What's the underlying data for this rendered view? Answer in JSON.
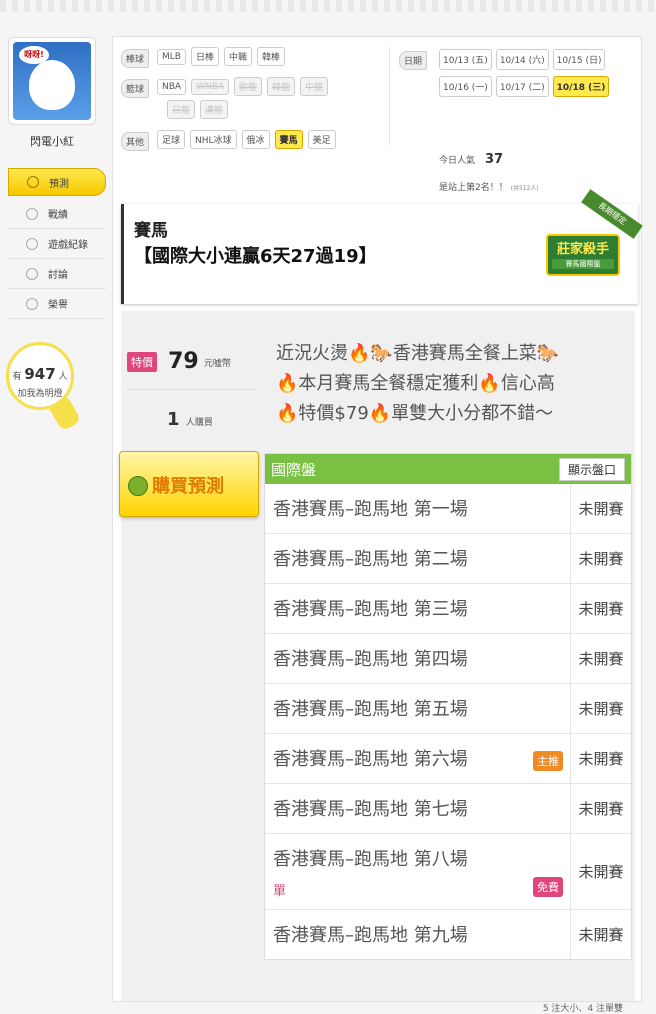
{
  "user": {
    "name": "閃電小紅",
    "avatar_text": "呀呀!"
  },
  "sidebar": {
    "items": [
      {
        "label": "預測",
        "icon": "target-icon"
      },
      {
        "label": "戰績",
        "icon": "chat-icon"
      },
      {
        "label": "遊戲紀錄",
        "icon": "circle-icon"
      },
      {
        "label": "討論",
        "icon": "pencil-icon"
      },
      {
        "label": "榮譽",
        "icon": "medal-icon"
      }
    ]
  },
  "bulb": {
    "prefix": "有",
    "count": "947",
    "suffix": "人",
    "line2": "加我為明燈"
  },
  "filters": {
    "baseball": {
      "label": "棒球",
      "items": [
        "MLB",
        "日棒",
        "中職",
        "韓棒"
      ]
    },
    "basketball": {
      "label": "籃球",
      "items": [
        "NBA",
        "WNBA",
        "歐籃",
        "韓籃",
        "中籃",
        "日籃",
        "澳籃"
      ]
    },
    "other": {
      "label": "其他",
      "items": [
        "足球",
        "NHL冰球",
        "俄冰",
        "賽馬",
        "美足"
      ]
    }
  },
  "dates": {
    "label": "日期",
    "items": [
      "10/13 (五)",
      "10/14 (六)",
      "10/15 (日)",
      "10/16 (一)",
      "10/17 (二)",
      "10/18 (三)"
    ],
    "selected": "10/18 (三)"
  },
  "popularity": {
    "label": "今日人氣",
    "value": "37",
    "rank_text": "是站上第2名！！",
    "rank_sub": "(共512人)"
  },
  "title": {
    "sport": "賽馬",
    "headline": "【國際大小連贏6天27過19】"
  },
  "badge": {
    "ribbon": "長期穩定",
    "main": "莊家殺手",
    "sub": "賽馬國際盤"
  },
  "price": {
    "tag": "特價",
    "amount": "79",
    "unit": "元噓幣",
    "buyers": "1",
    "buyers_unit": "人購買"
  },
  "promo": [
    "近況火燙🔥🐎香港賽馬全餐上菜🐎",
    "🔥本月賽馬全餐穩定獲利🔥信心高",
    "🔥特價$79🔥單雙大小分都不錯～"
  ],
  "buy_button": {
    "label": "購買預測"
  },
  "market": {
    "title": "國際盤",
    "show_button": "顯示盤口",
    "rows": [
      {
        "race": "香港賽馬–跑馬地 第一場",
        "status": "未開賽"
      },
      {
        "race": "香港賽馬–跑馬地 第二場",
        "status": "未開賽"
      },
      {
        "race": "香港賽馬–跑馬地 第三場",
        "status": "未開賽"
      },
      {
        "race": "香港賽馬–跑馬地 第四場",
        "status": "未開賽"
      },
      {
        "race": "香港賽馬–跑馬地 第五場",
        "status": "未開賽"
      },
      {
        "race": "香港賽馬–跑馬地 第六場",
        "status": "未開賽",
        "tag": "主推"
      },
      {
        "race": "香港賽馬–跑馬地 第七場",
        "status": "未開賽"
      },
      {
        "race": "香港賽馬–跑馬地 第八場",
        "status": "未開賽",
        "pick": "單",
        "tag": "免費"
      },
      {
        "race": "香港賽馬–跑馬地 第九場",
        "status": "未開賽"
      }
    ],
    "footer": "5 注大小、4 注單雙"
  }
}
